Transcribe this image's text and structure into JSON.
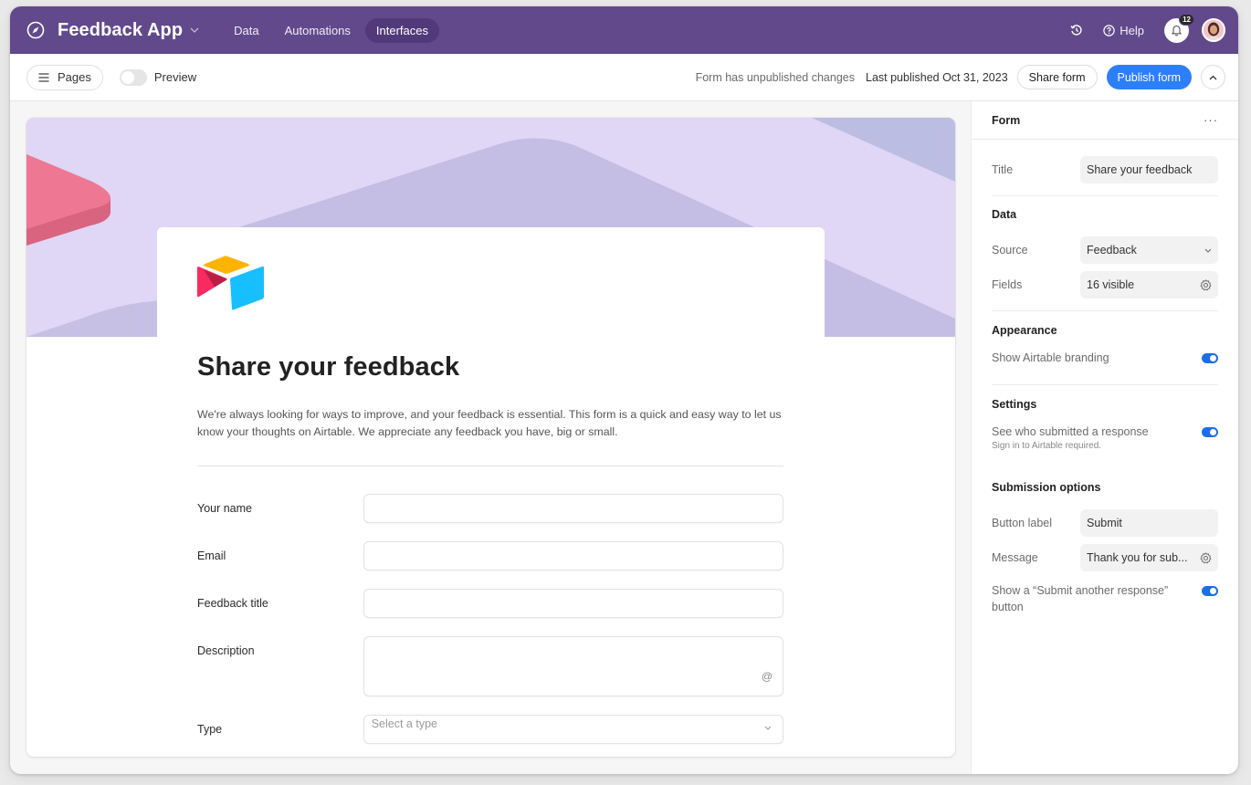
{
  "topbar": {
    "app_title": "Feedback App",
    "nav": [
      {
        "label": "Data",
        "active": false
      },
      {
        "label": "Automations",
        "active": false
      },
      {
        "label": "Interfaces",
        "active": true
      }
    ],
    "help_label": "Help",
    "notification_count": "12",
    "brand_color": "#62498c"
  },
  "toolbar": {
    "pages_label": "Pages",
    "preview_label": "Preview",
    "preview_enabled": false,
    "status_text": "Form has unpublished changes",
    "last_published": "Last published Oct 31, 2023",
    "share_label": "Share form",
    "publish_label": "Publish form",
    "accent_color": "#2d7ff9"
  },
  "form": {
    "title": "Share your feedback",
    "description": "We're always looking for ways to improve, and your feedback is essential. This form is a quick and easy way to let us know your thoughts on Airtable. We appreciate any feedback you have, big or small.",
    "fields": [
      {
        "label": "Your name",
        "type": "text",
        "value": ""
      },
      {
        "label": "Email",
        "type": "text",
        "value": ""
      },
      {
        "label": "Feedback title",
        "type": "text",
        "value": ""
      },
      {
        "label": "Description",
        "type": "long-text",
        "value": "",
        "icon": "at-icon"
      },
      {
        "label": "Type",
        "type": "select",
        "placeholder": "Select a type"
      }
    ]
  },
  "panel": {
    "header": "Form",
    "title_label": "Title",
    "title_value": "Share your feedback",
    "data_section": "Data",
    "source_label": "Source",
    "source_value": "Feedback",
    "fields_label": "Fields",
    "fields_value": "16 visible",
    "appearance_section": "Appearance",
    "branding_label": "Show Airtable branding",
    "branding_enabled": true,
    "settings_section": "Settings",
    "submitter_label": "See who submitted a response",
    "submitter_sub": "Sign in to Airtable required.",
    "submitter_enabled": true,
    "submission_section": "Submission options",
    "button_label_label": "Button label",
    "button_label_value": "Submit",
    "message_label": "Message",
    "message_value": "Thank you for sub...",
    "another_label": "Show a “Submit another response” button",
    "another_enabled": true
  }
}
